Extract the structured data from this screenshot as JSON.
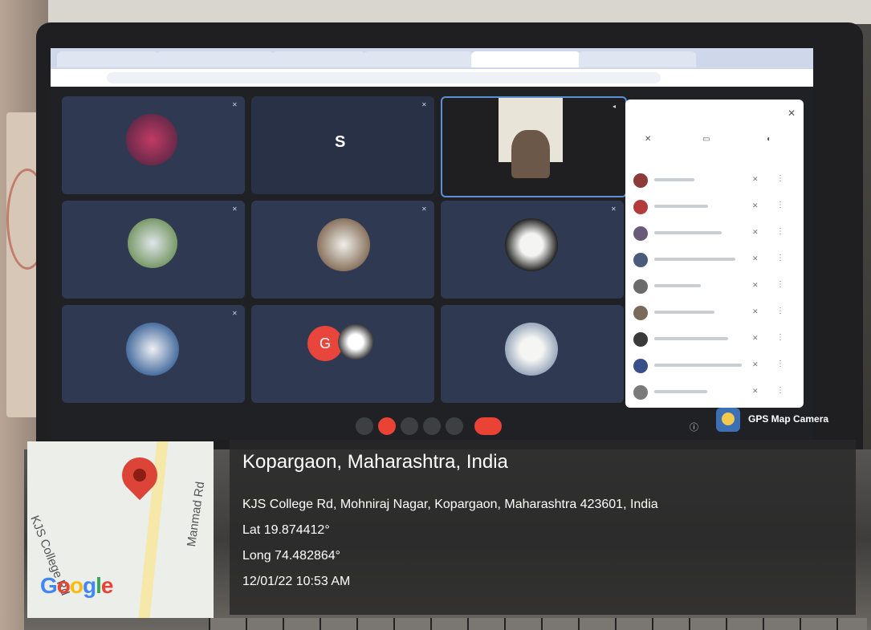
{
  "meet": {
    "tabs": [
      "",
      "",
      "",
      "",
      "",
      ""
    ],
    "url": "",
    "tiles": [
      {
        "name": "",
        "kind": "photo"
      },
      {
        "name": "",
        "kind": "letter",
        "letter": "S"
      },
      {
        "name": "",
        "kind": "video"
      },
      {
        "name": "",
        "kind": "photo"
      },
      {
        "name": "",
        "kind": "photo"
      },
      {
        "name": "",
        "kind": "photo"
      },
      {
        "name": "",
        "kind": "photo"
      },
      {
        "name": "",
        "kind": "group",
        "letter": "G"
      },
      {
        "name": "",
        "kind": "photo"
      }
    ],
    "people_title": "",
    "participant_count": 9,
    "time_text": "",
    "colors": {
      "accent": "#1a73e8",
      "end_call": "#ea4335",
      "tile_bg": "#2f3a52"
    }
  },
  "gps_badge": {
    "label": "GPS Map Camera"
  },
  "location": {
    "title": "Kopargaon, Maharashtra, India",
    "address": "KJS College Rd, Mohniraj Nagar, Kopargaon, Maharashtra 423601, India",
    "lat": "Lat 19.874412°",
    "long": "Long 74.482864°",
    "datetime": "12/01/22 10:53 AM"
  },
  "map": {
    "road1": "KJS College Rd",
    "road2": "Manmad Rd",
    "logo_text": "Google"
  }
}
